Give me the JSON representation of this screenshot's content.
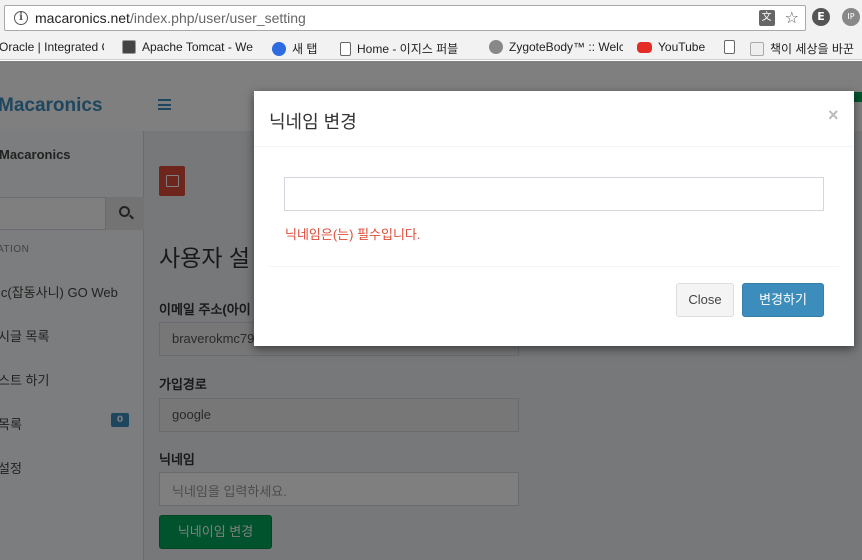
{
  "browser": {
    "url_host": "macaronics.net",
    "url_path": "/index.php/user/user_setting",
    "bookmarks": [
      {
        "label": "Oracle | Integrated C",
        "icon": "oracle-icon"
      },
      {
        "label": "Apache Tomcat - We",
        "icon": "tomcat-icon"
      },
      {
        "label": "새 탭",
        "icon": "search-icon"
      },
      {
        "label": "Home - 이지스 퍼블",
        "icon": "page-icon"
      },
      {
        "label": "ZygoteBody™ :: Welc",
        "icon": "zygote-icon"
      },
      {
        "label": "YouTube",
        "icon": "youtube-icon"
      },
      {
        "label": "",
        "icon": "page-icon"
      },
      {
        "label": "책이 세상을 바꾼",
        "icon": "book-icon"
      }
    ]
  },
  "app": {
    "brand": "Macaronics",
    "sidebar": {
      "user": "Macaronics",
      "header": "ATION",
      "items": [
        {
          "label": "ic(잡동사니) GO Web"
        },
        {
          "label": "시글 목록"
        },
        {
          "label": "스트 하기"
        },
        {
          "label": "목록",
          "badge": "0"
        },
        {
          "label": "설정"
        }
      ]
    },
    "content": {
      "title": "사용자 설",
      "email_label": "이메일 주소(아이",
      "email_value": "braverokmc79@g",
      "signup_label": "가입경로",
      "signup_value": "google",
      "nickname_label": "닉네임",
      "nickname_placeholder": "닉네임을 입력하세요.",
      "submit_label": "닉네이임 변경"
    }
  },
  "modal": {
    "title": "닉네임 변경",
    "close_x": "×",
    "input_value": "",
    "error": "닉네임은(는) 필수입니다.",
    "close_label": "Close",
    "submit_label": "변경하기"
  },
  "colors": {
    "accent": "#3c8dbc",
    "error": "#dd4b39",
    "success": "#00a65a"
  }
}
